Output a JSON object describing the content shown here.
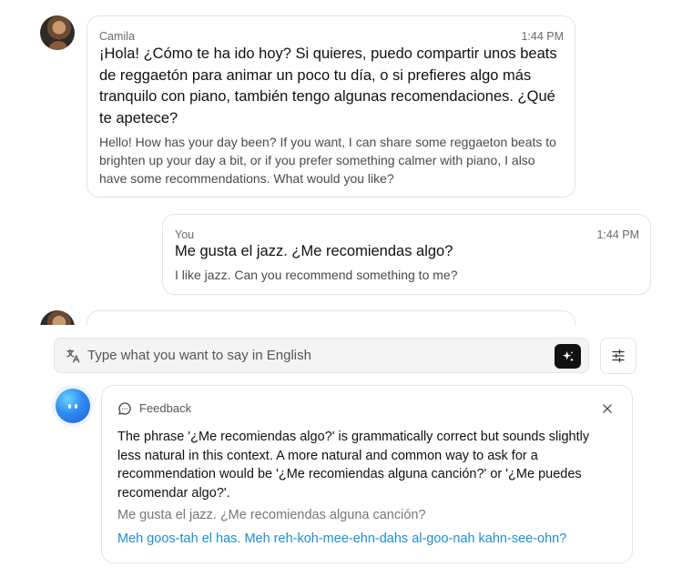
{
  "messages": [
    {
      "sender": "Camila",
      "time": "1:44 PM",
      "text": "¡Hola! ¿Cómo te ha ido hoy? Si quieres, puedo compartir unos beats de reggaetón para animar un poco tu día, o si prefieres algo más tranquilo con piano, también tengo algunas recomendaciones. ¿Qué te apetece?",
      "translation": "Hello! How has your day been? If you want, I can share some reggaeton beats to brighten up your day a bit, or if you prefer something calmer with piano, I also have some recommendations. What would you like?"
    },
    {
      "sender": "You",
      "time": "1:44 PM",
      "text": "Me gusta el jazz. ¿Me recomiendas algo?",
      "translation": "I like jazz. Can you recommend something to me?"
    }
  ],
  "composer": {
    "placeholder": "Type what you want to say in English"
  },
  "feedback": {
    "label": "Feedback",
    "text": "The phrase '¿Me recomiendas algo?' is grammatically correct but sounds slightly less natural in this context. A more natural and common way to ask for a recommendation would be '¿Me recomiendas alguna canción?' or '¿Me puedes recomendar algo?'.",
    "suggestion": "Me gusta el jazz. ¿Me recomiendas alguna canción?",
    "phonetic": "Meh goos-tah el has. Meh reh-koh-mee-ehn-dahs al-goo-nah kahn-see-ohn?"
  },
  "colors": {
    "accent_link": "#1e8fd0",
    "button_dark": "#111111",
    "border": "#e4e4e7"
  }
}
